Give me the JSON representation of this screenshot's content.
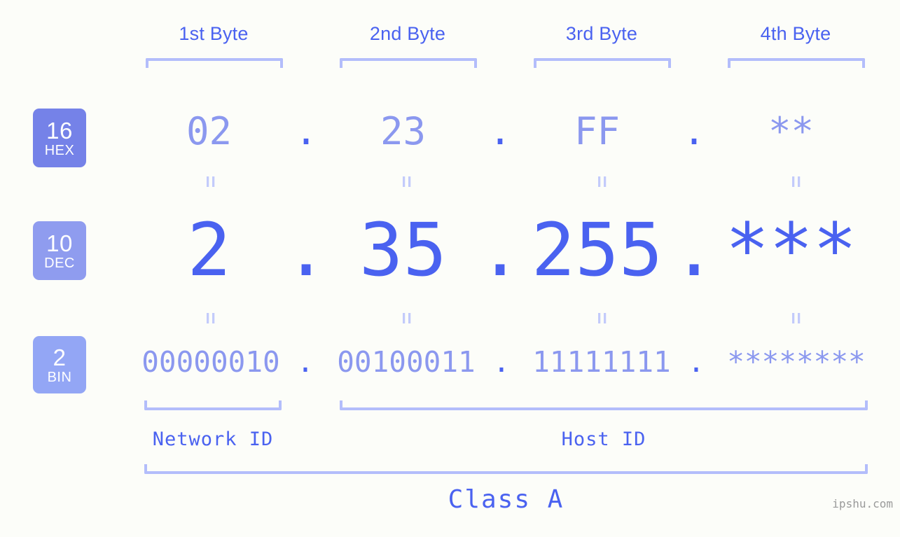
{
  "background_color": "#fcfdf9",
  "accent_colors": {
    "strong_blue": "#4a62f0",
    "medium_blue": "#8b98ef",
    "light_blue": "#b3bdfb",
    "pale_blue": "#c3cbfb",
    "badge_hex": "#7582e8",
    "badge_dec": "#8f9cef",
    "badge_bin": "#93a6f5",
    "watermark_gray": "#9a9a9a"
  },
  "byte_headers": [
    {
      "label": "1st Byte"
    },
    {
      "label": "2nd Byte"
    },
    {
      "label": "3rd Byte"
    },
    {
      "label": "4th Byte"
    }
  ],
  "radix_badges": [
    {
      "number": "16",
      "name": "HEX"
    },
    {
      "number": "10",
      "name": "DEC"
    },
    {
      "number": "2",
      "name": "BIN"
    }
  ],
  "rows": {
    "hex": {
      "radix": "16",
      "radix_name": "HEX",
      "values": [
        "02",
        "23",
        "FF",
        "**"
      ],
      "separator": "."
    },
    "dec": {
      "radix": "10",
      "radix_name": "DEC",
      "values": [
        "2",
        "35",
        "255",
        "***"
      ],
      "separator": "."
    },
    "bin": {
      "radix": "2",
      "radix_name": "BIN",
      "values": [
        "00000010",
        "00100011",
        "11111111",
        "********"
      ],
      "separator": "."
    }
  },
  "equals_marks": {
    "glyph": "=",
    "count_per_gap": 4,
    "gaps": 2
  },
  "segments": {
    "network_id": "Network ID",
    "host_id": "Host ID",
    "class": "Class A"
  },
  "watermark": "ipshu.com"
}
